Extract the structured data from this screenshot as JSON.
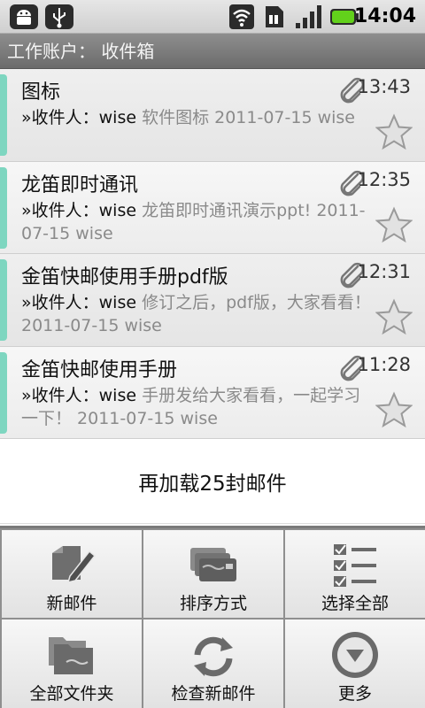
{
  "status_bar": {
    "time": "14:04",
    "icons": [
      "android-debug-icon",
      "usb-icon",
      "wifi-icon",
      "sim-icon",
      "signal-icon",
      "battery-icon"
    ]
  },
  "title": "工作账户：  收件箱",
  "mails": [
    {
      "subject": "图标",
      "time": "13:43",
      "recipient_label": "»收件人：",
      "recipient": "wise",
      "snippet": " 软件图标 2011-07-15 wise",
      "has_attachment": true,
      "accent": "#7ed6c0"
    },
    {
      "subject": "龙笛即时通讯",
      "time": "12:35",
      "recipient_label": "»收件人：",
      "recipient": "wise",
      "snippet": " 龙笛即时通讯演示ppt! 2011-07-15 wise",
      "has_attachment": true,
      "accent": "#7ed6c0"
    },
    {
      "subject": "金笛快邮使用手册pdf版",
      "time": "12:31",
      "recipient_label": "»收件人：",
      "recipient": "wise",
      "snippet": " 修订之后，pdf版，大家看看！ 2011-07-15 wise",
      "has_attachment": true,
      "accent": "#7ed6c0"
    },
    {
      "subject": "金笛快邮使用手册",
      "time": "11:28",
      "recipient_label": "»收件人：",
      "recipient": "wise",
      "snippet": " 手册发给大家看看，一起学习一下！ 2011-07-15 wise",
      "has_attachment": true,
      "accent": "#7ed6c0"
    }
  ],
  "load_more": "再加载25封邮件",
  "menu": [
    {
      "label": "新邮件",
      "icon": "compose-icon"
    },
    {
      "label": "排序方式",
      "icon": "sort-icon"
    },
    {
      "label": "选择全部",
      "icon": "select-all-icon"
    },
    {
      "label": "全部文件夹",
      "icon": "folders-icon"
    },
    {
      "label": "检查新邮件",
      "icon": "refresh-icon"
    },
    {
      "label": "更多",
      "icon": "more-icon"
    }
  ]
}
